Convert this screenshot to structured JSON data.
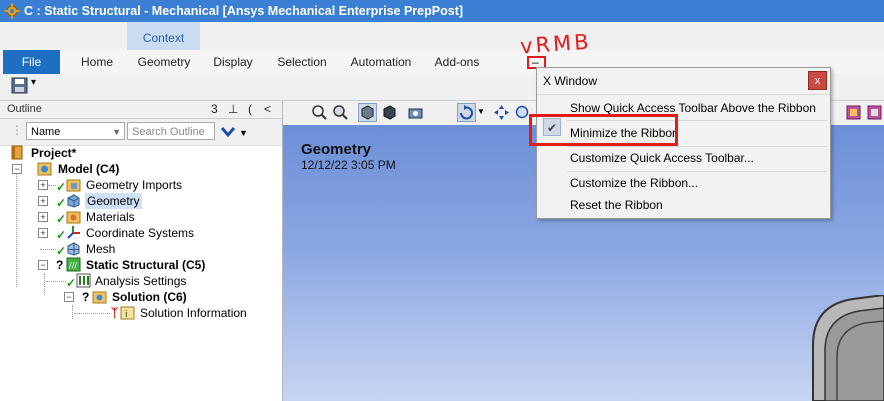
{
  "window": {
    "title": "C : Static Structural - Mechanical [Ansys Mechanical Enterprise PrepPost]"
  },
  "ribbon": {
    "context_label": "Context",
    "tabs": [
      {
        "label": "File"
      },
      {
        "label": "Home"
      },
      {
        "label": "Geometry"
      },
      {
        "label": "Display"
      },
      {
        "label": "Selection"
      },
      {
        "label": "Automation"
      },
      {
        "label": "Add-ons"
      }
    ]
  },
  "outline": {
    "title": "Outline",
    "pin_controls": [
      "3",
      "∅",
      "(",
      "<"
    ],
    "filter": {
      "name_value": "Name",
      "search_placeholder": "Search Outline"
    },
    "tree": [
      {
        "label": "Project*"
      },
      {
        "label": "Model (C4)"
      },
      {
        "label": "Geometry Imports"
      },
      {
        "label": "Geometry"
      },
      {
        "label": "Materials"
      },
      {
        "label": "Coordinate Systems"
      },
      {
        "label": "Mesh"
      },
      {
        "label": "Static Structural (C5)"
      },
      {
        "label": "Analysis Settings"
      },
      {
        "label": "Solution (C6)"
      },
      {
        "label": "Solution Information"
      }
    ]
  },
  "viewport": {
    "title": "Geometry",
    "date": "12/12/22 3:05 PM"
  },
  "context_menu": {
    "header": "X Window",
    "close_symbol": "x",
    "items": [
      {
        "label": "Show Quick Access Toolbar Above the Ribbon"
      },
      {
        "label": "Minimize the Ribbon",
        "checked": true
      },
      {
        "label": "Customize Quick Access Toolbar..."
      },
      {
        "label": "Customize the Ribbon..."
      },
      {
        "label": "Reset the Ribbon"
      }
    ]
  },
  "annotation": {
    "text": "vRMB"
  },
  "colors": {
    "title_bar": "#3a7fd4",
    "file_tab": "#1e6fc4",
    "highlight": "#e21b1b",
    "viewport_top": "#6c8fd8",
    "viewport_bottom": "#c7d5f2"
  }
}
